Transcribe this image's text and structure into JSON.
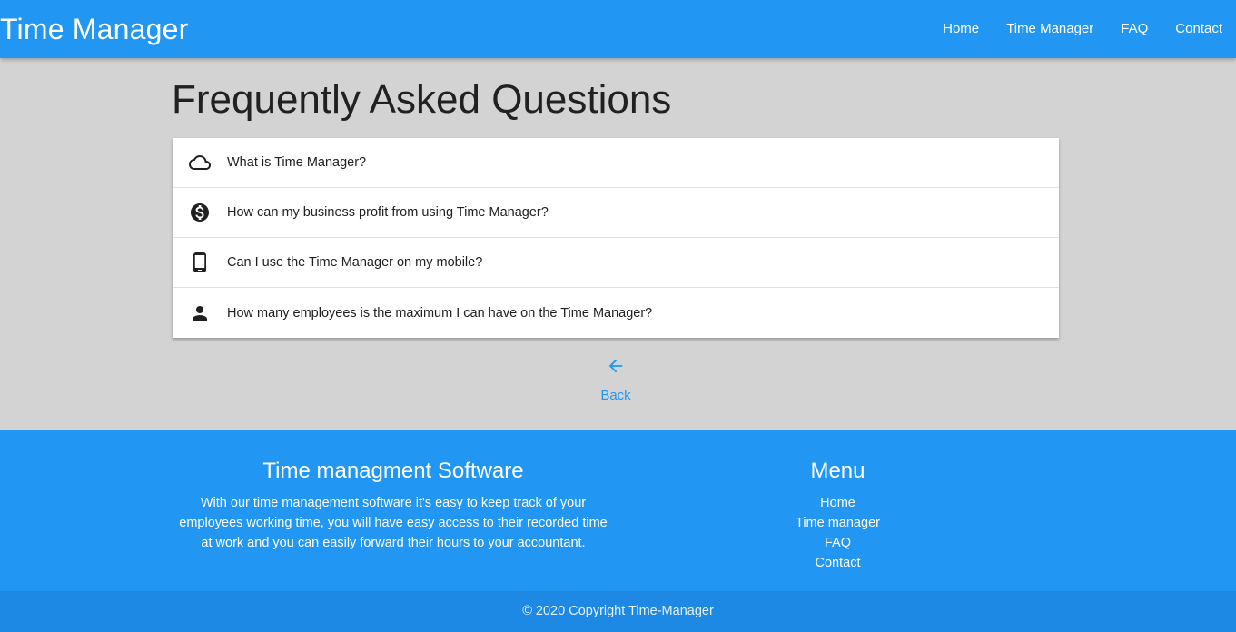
{
  "navbar": {
    "brand": "Time Manager",
    "links": [
      "Home",
      "Time Manager",
      "FAQ",
      "Contact"
    ]
  },
  "main": {
    "title": "Frequently Asked Questions",
    "faqs": [
      {
        "icon": "cloud-icon",
        "question": "What is Time Manager?"
      },
      {
        "icon": "dollar-icon",
        "question": "How can my business profit from using Time Manager?"
      },
      {
        "icon": "smartphone-icon",
        "question": "Can I use the Time Manager on my mobile?"
      },
      {
        "icon": "person-icon",
        "question": "How many employees is the maximum I can have on the Time Manager?"
      }
    ],
    "back_label": "Back"
  },
  "footer": {
    "about_title": "Time managment Software",
    "about_text": "With our time management software it's easy to keep track of your employees working time, you will have easy access to their recorded time at work and you can easily forward their hours to your accountant.",
    "menu_title": "Menu",
    "menu_links": [
      "Home",
      "Time manager",
      "FAQ",
      "Contact"
    ],
    "copyright": "© 2020 Copyright Time-Manager"
  },
  "colors": {
    "primary": "#2196f3",
    "copyright_bar": "#1e88e5",
    "page_background": "#d3d3d3"
  }
}
